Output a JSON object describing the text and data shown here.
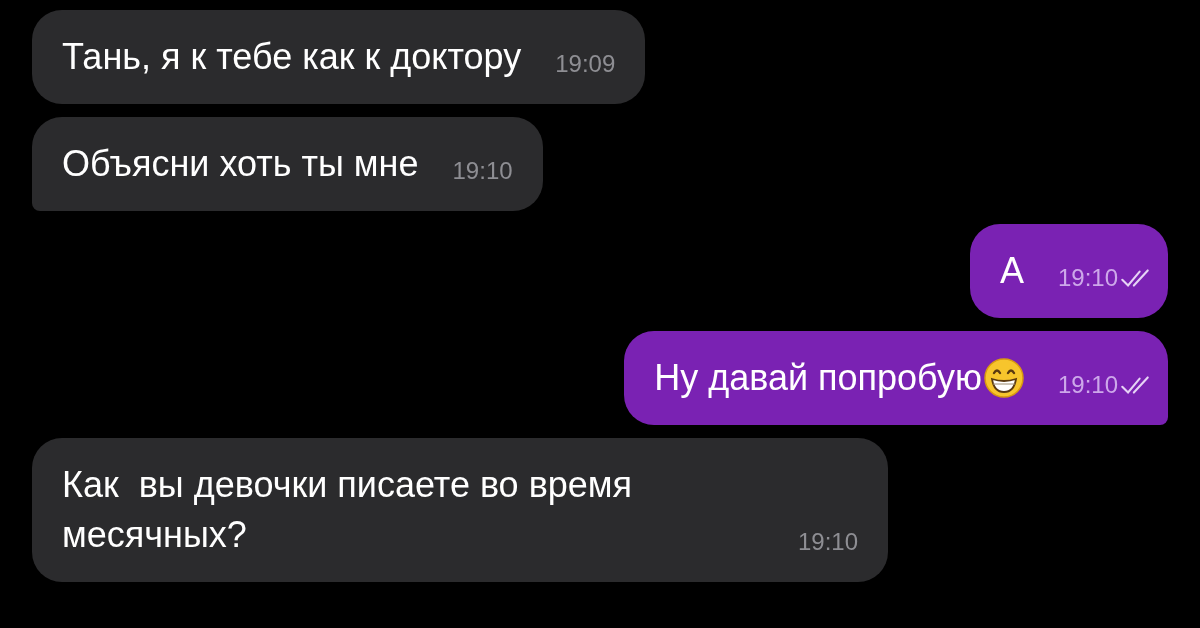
{
  "messages": [
    {
      "kind": "incoming",
      "text": "Тань, я к тебе как к доктору",
      "time": "19:09",
      "tail": false
    },
    {
      "kind": "incoming",
      "text": "Объясни хоть ты мне",
      "time": "19:10",
      "tail": true
    },
    {
      "kind": "outgoing",
      "text": "А",
      "time": "19:10",
      "tail": false,
      "read": true
    },
    {
      "kind": "outgoing",
      "text": "Ну давай попробую",
      "emoji": true,
      "time": "19:10",
      "tail": true,
      "read": true
    },
    {
      "kind": "incoming",
      "text": "Как  вы девочки писаете во время месячных?",
      "time": "19:10",
      "tail": false
    }
  ]
}
